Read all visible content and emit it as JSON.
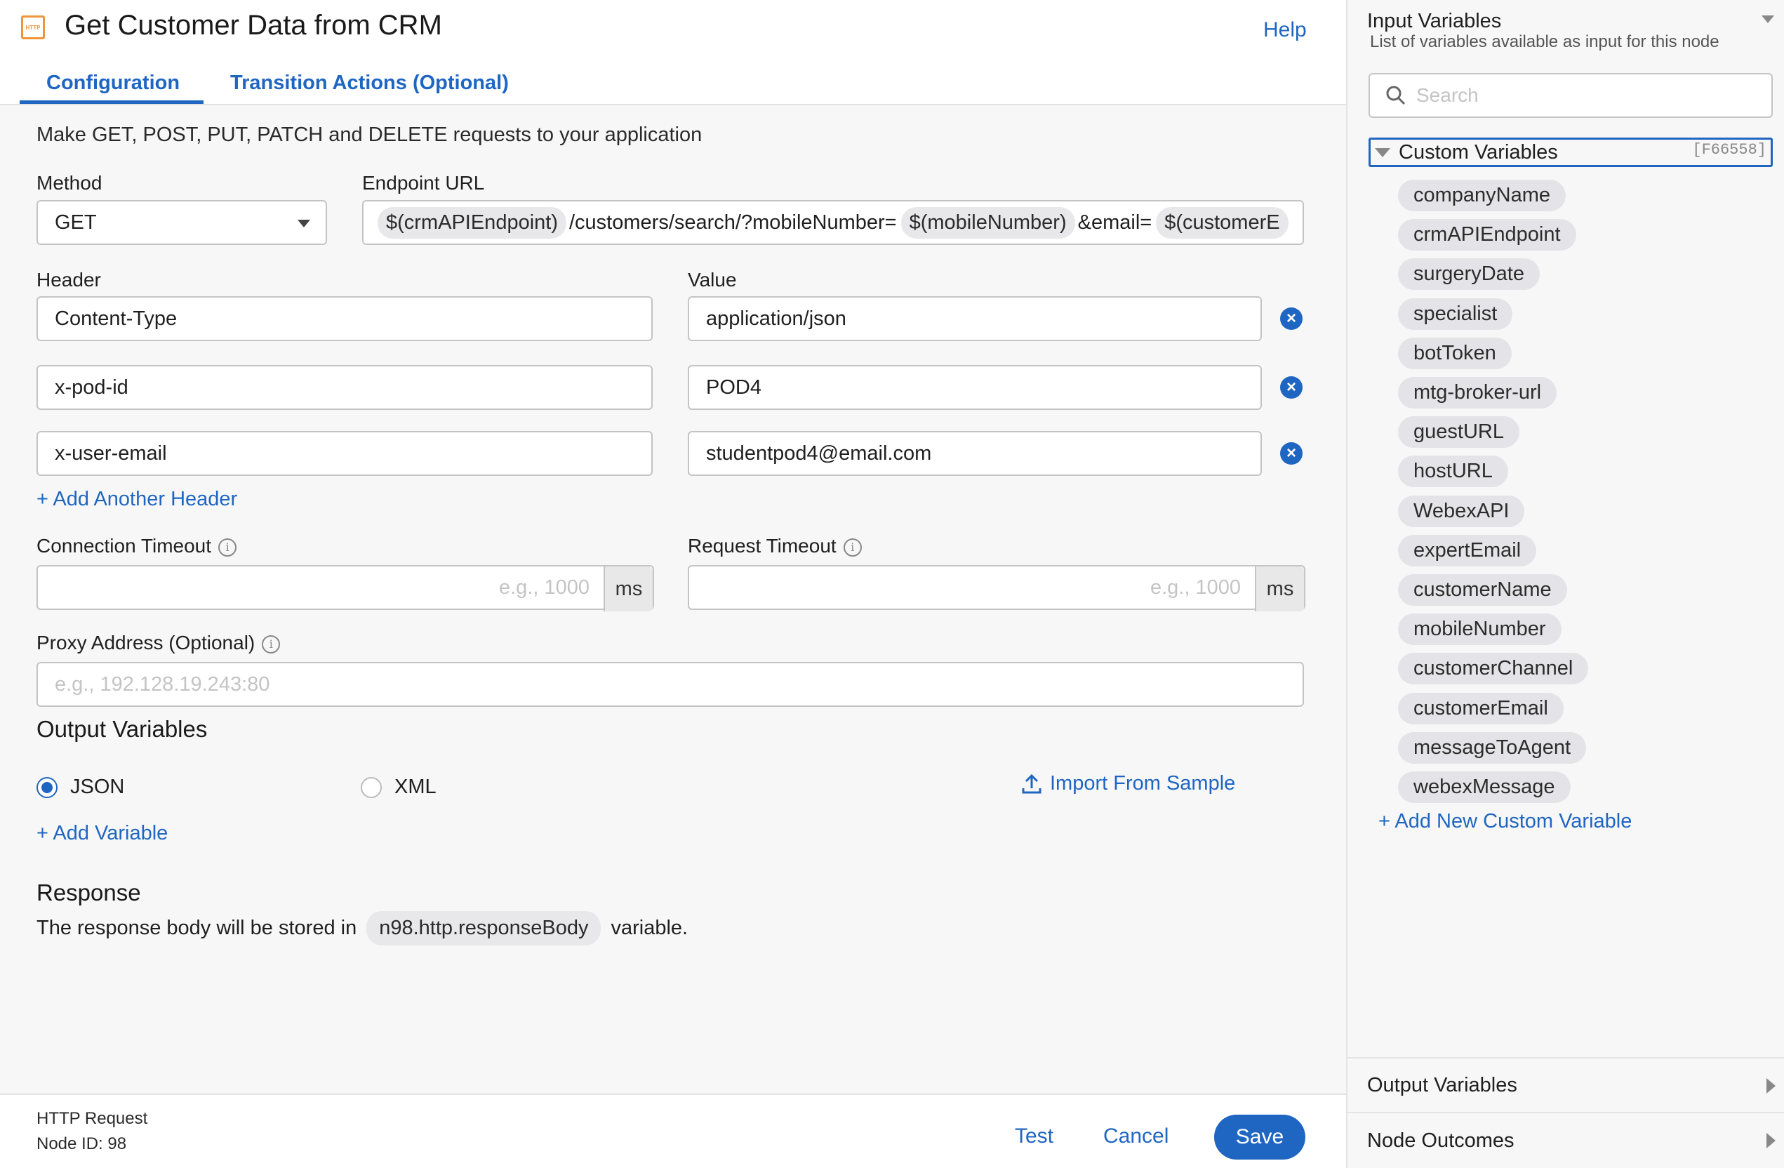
{
  "header": {
    "icon_text": "HTTP",
    "title": "Get Customer Data from CRM",
    "help_label": "Help"
  },
  "tabs": [
    {
      "label": "Configuration",
      "active": true
    },
    {
      "label": "Transition Actions (Optional)",
      "active": false
    }
  ],
  "form": {
    "description": "Make GET, POST, PUT, PATCH and DELETE requests to your application",
    "method_label": "Method",
    "method_value": "GET",
    "endpoint_label": "Endpoint URL",
    "endpoint_parts": {
      "var1": "$(crmAPIEndpoint)",
      "text1": "/customers/search/?mobileNumber=",
      "var2": "$(mobileNumber)",
      "text2": "&email=",
      "var3": "$(customerE"
    },
    "header_label": "Header",
    "value_label": "Value",
    "headers": [
      {
        "key": "Content-Type",
        "value": "application/json"
      },
      {
        "key": "x-pod-id",
        "value": "POD4"
      },
      {
        "key": "x-user-email",
        "value": "studentpod4@email.com"
      }
    ],
    "add_header_label": "+ Add Another Header",
    "connection_timeout_label": "Connection Timeout",
    "connection_timeout_placeholder": "e.g., 1000",
    "request_timeout_label": "Request Timeout",
    "request_timeout_placeholder": "e.g., 1000",
    "timeout_unit": "ms",
    "proxy_label": "Proxy Address (Optional)",
    "proxy_placeholder": "e.g., 192.128.19.243:80",
    "output_variables_title": "Output Variables",
    "format_json": "JSON",
    "format_xml": "XML",
    "selected_format": "JSON",
    "import_label": "Import From Sample",
    "add_variable_label": "+ Add Variable",
    "response_title": "Response",
    "response_prefix": "The response body will be stored in",
    "response_variable": "n98.http.responseBody",
    "response_suffix": "variable."
  },
  "footer": {
    "node_type": "HTTP Request",
    "node_id": "Node ID: 98",
    "test_label": "Test",
    "cancel_label": "Cancel",
    "save_label": "Save"
  },
  "sidebar": {
    "title": "Input Variables",
    "subtitle": "List of variables available as input for this node",
    "search_placeholder": "Search",
    "group_label": "Custom Variables",
    "group_tag": "[F66558]",
    "variables": [
      "companyName",
      "crmAPIEndpoint",
      "surgeryDate",
      "specialist",
      "botToken",
      "mtg-broker-url",
      "guestURL",
      "hostURL",
      "WebexAPI",
      "expertEmail",
      "customerName",
      "mobileNumber",
      "customerChannel",
      "customerEmail",
      "messageToAgent",
      "webexMessage"
    ],
    "add_custom_label": "+ Add New Custom Variable",
    "output_variables_label": "Output Variables",
    "node_outcomes_label": "Node Outcomes"
  },
  "colors": {
    "accent": "#1f66c2",
    "http_icon": "#f0953a",
    "chip_bg": "#e8e8ea",
    "panel_bg": "#f7f7f7"
  }
}
